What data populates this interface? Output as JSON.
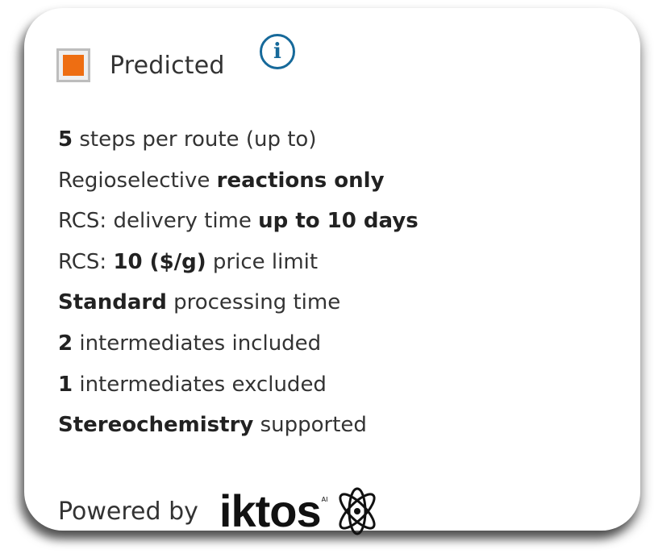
{
  "legend": {
    "label": "Predicted",
    "swatch_color": "#ee6e12",
    "info_icon": "info-circle-icon"
  },
  "features": [
    [
      {
        "text": "5",
        "bold": true
      },
      {
        "text": " steps per route (up to)",
        "bold": false
      }
    ],
    [
      {
        "text": "Regioselective ",
        "bold": false
      },
      {
        "text": "reactions only",
        "bold": true
      }
    ],
    [
      {
        "text": "RCS: delivery time ",
        "bold": false
      },
      {
        "text": "up to 10 days",
        "bold": true
      }
    ],
    [
      {
        "text": "RCS: ",
        "bold": false
      },
      {
        "text": "10 ($/g)",
        "bold": true
      },
      {
        "text": " price limit",
        "bold": false
      }
    ],
    [
      {
        "text": "Standard",
        "bold": true
      },
      {
        "text": " processing time",
        "bold": false
      }
    ],
    [
      {
        "text": "2",
        "bold": true
      },
      {
        "text": " intermediates included",
        "bold": false
      }
    ],
    [
      {
        "text": "1",
        "bold": true
      },
      {
        "text": " intermediates excluded",
        "bold": false
      }
    ],
    [
      {
        "text": "Stereochemistry",
        "bold": true
      },
      {
        "text": " supported",
        "bold": false
      }
    ]
  ],
  "footer": {
    "powered_by": "Powered by",
    "brand": "iktos",
    "brand_suffix": "AI",
    "brand_icon": "atom-icon"
  },
  "colors": {
    "accent_orange": "#ee6e12",
    "info_blue": "#16699a",
    "text": "#333333"
  }
}
